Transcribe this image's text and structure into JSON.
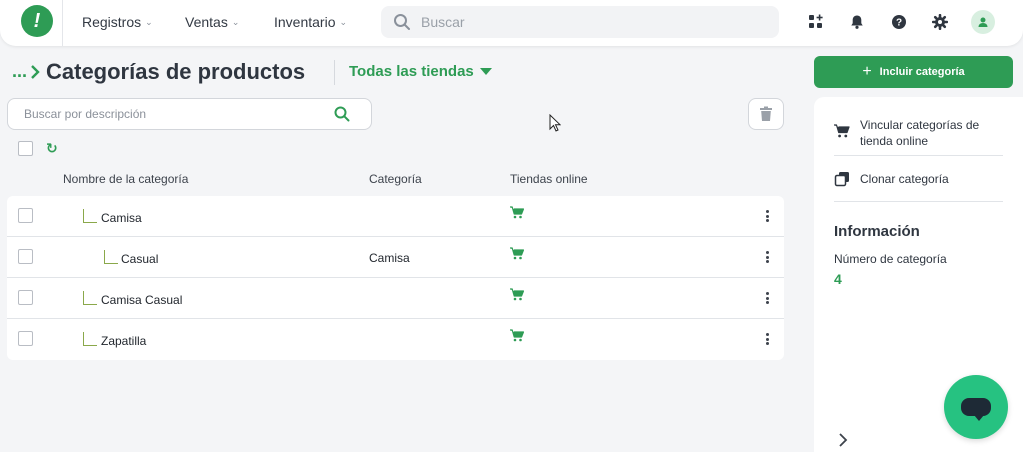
{
  "brand": {
    "accent": "#2e9c55",
    "logo_glyph": "!"
  },
  "nav": {
    "items": [
      {
        "label": "Registros"
      },
      {
        "label": "Ventas"
      },
      {
        "label": "Inventario"
      }
    ],
    "search_placeholder": "Buscar"
  },
  "top_icons": [
    "grid-plus-icon",
    "bell-icon",
    "help-icon",
    "gear-icon",
    "user-icon"
  ],
  "header": {
    "breadcrumb": "...",
    "title": "Categorías de productos",
    "store_filter": "Todas las tiendas"
  },
  "toolbar": {
    "search_placeholder": "Buscar por descripción"
  },
  "table": {
    "columns": [
      "Nombre de la categoría",
      "Categoría",
      "Tiendas online"
    ],
    "rows": [
      {
        "name": "Camisa",
        "parent": "",
        "level": 1
      },
      {
        "name": "Casual",
        "parent": "Camisa",
        "level": 2
      },
      {
        "name": "Camisa Casual",
        "parent": "",
        "level": 1
      },
      {
        "name": "Zapatilla",
        "parent": "",
        "level": 1
      }
    ]
  },
  "side": {
    "include_label": "Incluir categoría",
    "link_vincular": "Vincular categorías de tienda online",
    "link_clonar": "Clonar categoría",
    "info_title": "Información",
    "info_label": "Número de categoría",
    "info_value": "4"
  }
}
